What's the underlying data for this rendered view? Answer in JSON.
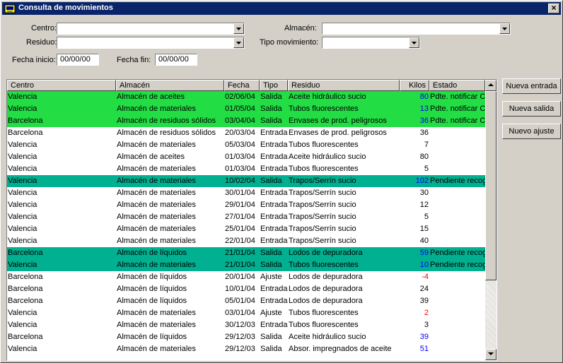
{
  "window": {
    "title": "Consulta de movimientos",
    "close_label": "×"
  },
  "filters": {
    "centro_label": "Centro:",
    "residuo_label": "Residuo:",
    "almacen_label": "Almacén:",
    "tipo_label": "Tipo movimiento:",
    "fecha_inicio_label": "Fecha inicio:",
    "fecha_inicio_value": "00/00/00",
    "fecha_fin_label": "Fecha fin:",
    "fecha_fin_value": "00/00/00"
  },
  "table": {
    "headers": [
      "Centro",
      "Almacén",
      "Fecha",
      "Tipo",
      "Residuo",
      "Kilos",
      "Estado"
    ],
    "rows": [
      {
        "centro": "Valencia",
        "almacen": "Almacén de aceites",
        "fecha": "02/06/04",
        "tipo": "Salida",
        "residuo": "Aceite hidráulico sucio",
        "kilos": "80",
        "estado": "Pdte. notificar Co",
        "bg": "#22dd44",
        "kcolor": "#0000ff"
      },
      {
        "centro": "Valencia",
        "almacen": "Almacén de materiales",
        "fecha": "01/05/04",
        "tipo": "Salida",
        "residuo": "Tubos fluorescentes",
        "kilos": "13",
        "estado": "Pdte. notificar Co",
        "bg": "#22dd44",
        "kcolor": "#0000ff"
      },
      {
        "centro": "Barcelona",
        "almacen": "Almacén de residuos sólidos",
        "fecha": "03/04/04",
        "tipo": "Salida",
        "residuo": "Envases de prod. peligrosos",
        "kilos": "36",
        "estado": "Pdte. notificar Co",
        "bg": "#22dd44",
        "kcolor": "#0000ff"
      },
      {
        "centro": "Barcelona",
        "almacen": "Almacén de residuos sólidos",
        "fecha": "20/03/04",
        "tipo": "Entrada",
        "residuo": "Envases de prod. peligrosos",
        "kilos": "36",
        "estado": "",
        "bg": "#ffffff",
        "kcolor": "#000000"
      },
      {
        "centro": "Valencia",
        "almacen": "Almacén de materiales",
        "fecha": "05/03/04",
        "tipo": "Entrada",
        "residuo": "Tubos fluorescentes",
        "kilos": "7",
        "estado": "",
        "bg": "#ffffff",
        "kcolor": "#000000"
      },
      {
        "centro": "Valencia",
        "almacen": "Almacén de aceites",
        "fecha": "01/03/04",
        "tipo": "Entrada",
        "residuo": "Aceite hidráulico sucio",
        "kilos": "80",
        "estado": "",
        "bg": "#ffffff",
        "kcolor": "#000000"
      },
      {
        "centro": "Valencia",
        "almacen": "Almacén de materiales",
        "fecha": "01/03/04",
        "tipo": "Entrada",
        "residuo": "Tubos fluorescentes",
        "kilos": "5",
        "estado": "",
        "bg": "#ffffff",
        "kcolor": "#000000"
      },
      {
        "centro": "Valencia",
        "almacen": "Almacén de materiales",
        "fecha": "10/02/04",
        "tipo": "Salida",
        "residuo": "Trapos/Serrín sucio",
        "kilos": "102",
        "estado": "Pendiente recog",
        "bg": "#00b090",
        "kcolor": "#0000ff"
      },
      {
        "centro": "Valencia",
        "almacen": "Almacén de materiales",
        "fecha": "30/01/04",
        "tipo": "Entrada",
        "residuo": "Trapos/Serrín sucio",
        "kilos": "30",
        "estado": "",
        "bg": "#ffffff",
        "kcolor": "#000000"
      },
      {
        "centro": "Valencia",
        "almacen": "Almacén de materiales",
        "fecha": "29/01/04",
        "tipo": "Entrada",
        "residuo": "Trapos/Serrín sucio",
        "kilos": "12",
        "estado": "",
        "bg": "#ffffff",
        "kcolor": "#000000"
      },
      {
        "centro": "Valencia",
        "almacen": "Almacén de materiales",
        "fecha": "27/01/04",
        "tipo": "Entrada",
        "residuo": "Trapos/Serrín sucio",
        "kilos": "5",
        "estado": "",
        "bg": "#ffffff",
        "kcolor": "#000000"
      },
      {
        "centro": "Valencia",
        "almacen": "Almacén de materiales",
        "fecha": "25/01/04",
        "tipo": "Entrada",
        "residuo": "Trapos/Serrín sucio",
        "kilos": "15",
        "estado": "",
        "bg": "#ffffff",
        "kcolor": "#000000"
      },
      {
        "centro": "Valencia",
        "almacen": "Almacén de materiales",
        "fecha": "22/01/04",
        "tipo": "Entrada",
        "residuo": "Trapos/Serrín sucio",
        "kilos": "40",
        "estado": "",
        "bg": "#ffffff",
        "kcolor": "#000000"
      },
      {
        "centro": "Barcelona",
        "almacen": "Almacén de líquidos",
        "fecha": "21/01/04",
        "tipo": "Salida",
        "residuo": "Lodos de depuradora",
        "kilos": "59",
        "estado": "Pendiente recog",
        "bg": "#00b090",
        "kcolor": "#0000ff"
      },
      {
        "centro": "Valencia",
        "almacen": "Almacén de materiales",
        "fecha": "21/01/04",
        "tipo": "Salida",
        "residuo": "Tubos fluorescentes",
        "kilos": "10",
        "estado": "Pendiente recog",
        "bg": "#00b090",
        "kcolor": "#0000ff"
      },
      {
        "centro": "Barcelona",
        "almacen": "Almacén de líquidos",
        "fecha": "20/01/04",
        "tipo": "Ajuste",
        "residuo": "Lodos de depuradora",
        "kilos": "-4",
        "estado": "",
        "bg": "#ffffff",
        "kcolor": "#ff0000"
      },
      {
        "centro": "Barcelona",
        "almacen": "Almacén de líquidos",
        "fecha": "10/01/04",
        "tipo": "Entrada",
        "residuo": "Lodos de depuradora",
        "kilos": "24",
        "estado": "",
        "bg": "#ffffff",
        "kcolor": "#000000"
      },
      {
        "centro": "Barcelona",
        "almacen": "Almacén de líquidos",
        "fecha": "05/01/04",
        "tipo": "Entrada",
        "residuo": "Lodos de depuradora",
        "kilos": "39",
        "estado": "",
        "bg": "#ffffff",
        "kcolor": "#000000"
      },
      {
        "centro": "Valencia",
        "almacen": "Almacén de materiales",
        "fecha": "03/01/04",
        "tipo": "Ajuste",
        "residuo": "Tubos fluorescentes",
        "kilos": "2",
        "estado": "",
        "bg": "#ffffff",
        "kcolor": "#ff0000"
      },
      {
        "centro": "Valencia",
        "almacen": "Almacén de materiales",
        "fecha": "30/12/03",
        "tipo": "Entrada",
        "residuo": "Tubos fluorescentes",
        "kilos": "3",
        "estado": "",
        "bg": "#ffffff",
        "kcolor": "#000000"
      },
      {
        "centro": "Barcelona",
        "almacen": "Almacén de líquidos",
        "fecha": "29/12/03",
        "tipo": "Salida",
        "residuo": "Aceite hidráulico sucio",
        "kilos": "39",
        "estado": "",
        "bg": "#ffffff",
        "kcolor": "#0000ff"
      },
      {
        "centro": "Valencia",
        "almacen": "Almacén de materiales",
        "fecha": "29/12/03",
        "tipo": "Salida",
        "residuo": "Absor. impregnados de aceite",
        "kilos": "51",
        "estado": "",
        "bg": "#ffffff",
        "kcolor": "#0000ff"
      }
    ]
  },
  "buttons": {
    "nueva_entrada": "Nueva entrada",
    "nueva_salida": "Nueva salida",
    "nuevo_ajuste": "Nuevo ajuste"
  }
}
